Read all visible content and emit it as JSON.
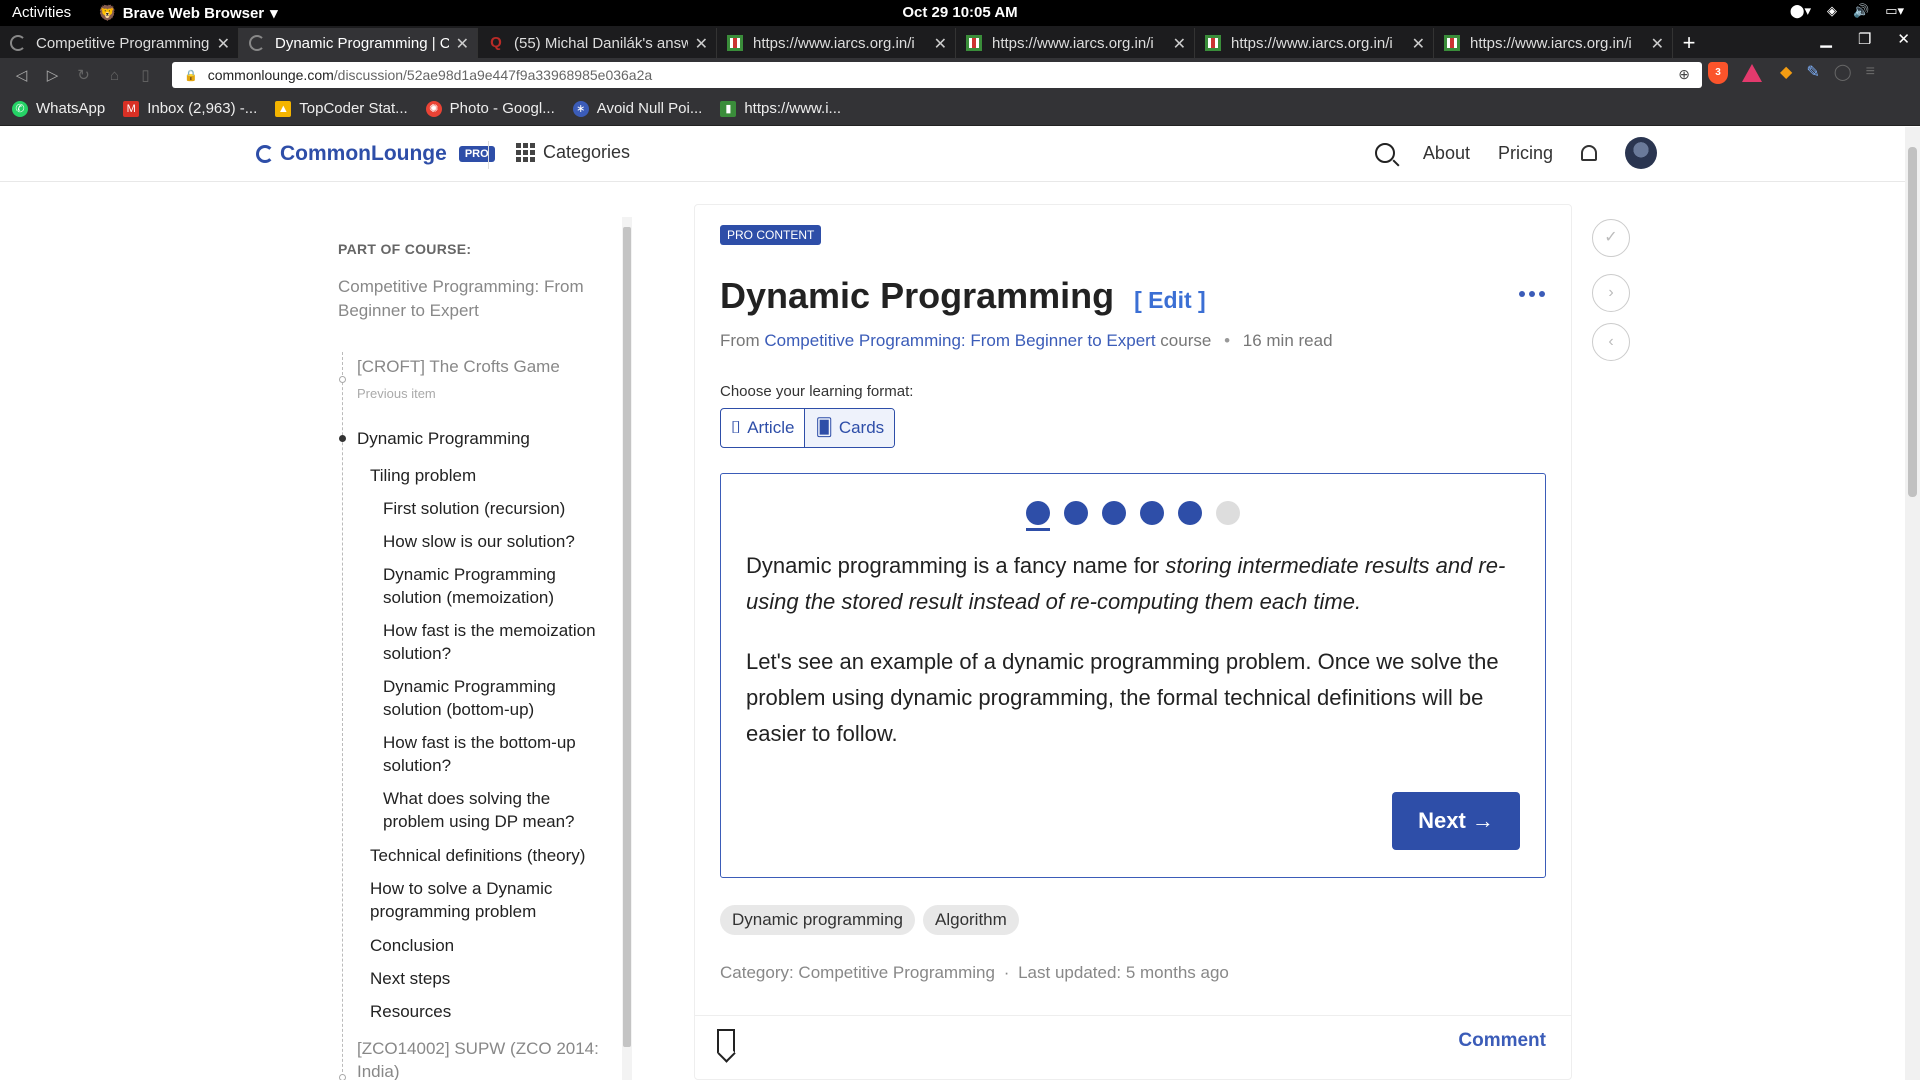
{
  "system": {
    "activities": "Activities",
    "app_name": "Brave Web Browser",
    "clock": "Oct 29  10:05 AM"
  },
  "tabs": [
    {
      "title": "Competitive Programming",
      "active": false,
      "icon": "loading-icon"
    },
    {
      "title": "Dynamic Programming | Co",
      "active": true,
      "icon": "loading-icon"
    },
    {
      "title": "(55) Michal Danilák's answ",
      "active": false,
      "icon": "quora-icon"
    },
    {
      "title": "https://www.iarcs.org.in/i",
      "active": false,
      "icon": "iarcs-icon"
    },
    {
      "title": "https://www.iarcs.org.in/i",
      "active": false,
      "icon": "iarcs-icon"
    },
    {
      "title": "https://www.iarcs.org.in/i",
      "active": false,
      "icon": "iarcs-icon"
    },
    {
      "title": "https://www.iarcs.org.in/i",
      "active": false,
      "icon": "iarcs-icon"
    }
  ],
  "address": {
    "host": "commonlounge.com",
    "path": "/discussion/52ae98d1a9e447f9a33968985e036a2a",
    "shield_count": "3"
  },
  "bookmarks": [
    {
      "label": "WhatsApp",
      "icon": "whatsapp-icon",
      "color": "#25d366"
    },
    {
      "label": "Inbox (2,963) -...",
      "icon": "gmail-icon",
      "color": "#d93025"
    },
    {
      "label": "TopCoder Stat...",
      "icon": "drive-icon",
      "color": "#f4b400"
    },
    {
      "label": "Photo - Googl...",
      "icon": "photos-icon",
      "color": "#ea4335"
    },
    {
      "label": "Avoid Null Poi...",
      "icon": "link-icon",
      "color": "#3b5cb8"
    },
    {
      "label": "https://www.i...",
      "icon": "iarcs-icon",
      "color": "#3a8d3a"
    }
  ],
  "header": {
    "logo": "CommonLounge",
    "pro": "PRO",
    "categories": "Categories",
    "about": "About",
    "pricing": "Pricing"
  },
  "sidebar": {
    "part_of_course": "PART OF COURSE:",
    "course": "Competitive Programming: From Beginner to Expert",
    "prev_title": "[CROFT] The Crofts Game",
    "prev_label": "Previous item",
    "current": "Dynamic Programming",
    "sections": [
      {
        "label": "Tiling problem",
        "level": 1
      },
      {
        "label": "First solution (recursion)",
        "level": 2
      },
      {
        "label": "How slow is our solution?",
        "level": 2
      },
      {
        "label": "Dynamic Programming solution (memoization)",
        "level": 2
      },
      {
        "label": "How fast is the memoization solution?",
        "level": 2
      },
      {
        "label": "Dynamic Programming solution (bottom-up)",
        "level": 2
      },
      {
        "label": "How fast is the bottom-up solution?",
        "level": 2
      },
      {
        "label": "What does solving the problem using DP mean?",
        "level": 2
      },
      {
        "label": "Technical definitions (theory)",
        "level": 1
      },
      {
        "label": "How to solve a Dynamic programming problem",
        "level": 1
      },
      {
        "label": "Conclusion",
        "level": 1
      },
      {
        "label": "Next steps",
        "level": 1
      },
      {
        "label": "Resources",
        "level": 1
      }
    ],
    "next_title": "[ZCO14002] SUPW (ZCO 2014: India)"
  },
  "article": {
    "pro_content": "PRO CONTENT",
    "title": "Dynamic Programming",
    "edit": "[ Edit ]",
    "from": "From",
    "course_link": "Competitive Programming: From Beginner to Expert",
    "course_word": "course",
    "read_time": "16 min read",
    "format_label": "Choose your learning format:",
    "format_article": "Article",
    "format_cards": "Cards",
    "selected_format": "Cards",
    "card_progress": {
      "current": 1,
      "total": 6,
      "filled": 5
    },
    "para1_plain": "Dynamic programming is a fancy name for ",
    "para1_em": "storing intermediate results and re-using the stored result instead of re-computing them each time.",
    "para2": "Let's see an example of a dynamic programming problem. Once we solve the problem using dynamic programming, the formal technical definitions will be easier to follow.",
    "next": "Next →",
    "tags": [
      "Dynamic programming",
      "Algorithm"
    ],
    "category": "Category: Competitive Programming",
    "updated": "Last updated: 5 months ago",
    "comment": "Comment"
  },
  "colors": {
    "brand": "#2e4ea8",
    "link": "#3b5cb8"
  }
}
